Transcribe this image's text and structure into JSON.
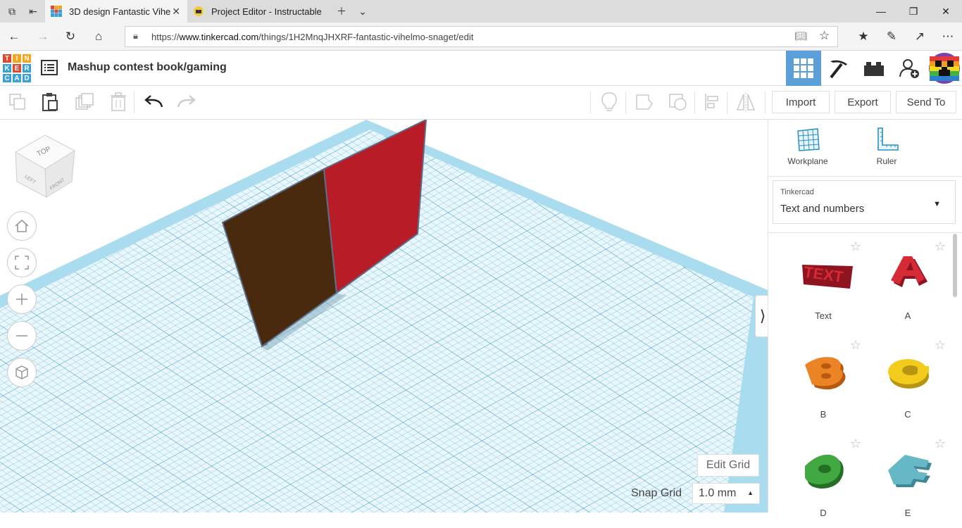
{
  "browser": {
    "tabs": [
      {
        "title": "3D design Fantastic Vihe",
        "active": true
      },
      {
        "title": "Project Editor - Instructable",
        "active": false
      }
    ],
    "url_prefix": "https://",
    "url_host": "www.tinkercad.com",
    "url_path": "/things/1H2MnqJHXRF-fantastic-vihelmo-snaget/edit"
  },
  "app": {
    "logo_letters": [
      "T",
      "I",
      "N",
      "K",
      "E",
      "R",
      "C",
      "A",
      "D"
    ],
    "logo_colors": [
      "#e2472c",
      "#f6a419",
      "#f6a419",
      "#3aa0d8",
      "#e2472c",
      "#3aa0d8",
      "#3aa0d8",
      "#3aa0d8",
      "#3aa0d8"
    ],
    "design_title": "Mashup contest book/gaming",
    "accent": "#5a9fd8"
  },
  "toolbar": {
    "import_label": "Import",
    "export_label": "Export",
    "sendto_label": "Send To"
  },
  "viewport": {
    "cube_top": "TOP",
    "cube_left": "LEFT",
    "cube_front": "FRONT",
    "edit_grid_label": "Edit Grid",
    "snap_grid_label": "Snap Grid",
    "snap_grid_value": "1.0 mm",
    "workplane_color": "#a9dcef",
    "brown_panel_color": "#4a2a0f",
    "red_panel_color": "#b81c26"
  },
  "panel": {
    "workplane_label": "Workplane",
    "ruler_label": "Ruler",
    "category_source": "Tinkercad",
    "category_value": "Text and numbers",
    "shapes": [
      {
        "label": "Text",
        "color": "#c8202e"
      },
      {
        "label": "A",
        "color": "#c8202e"
      },
      {
        "label": "B",
        "color": "#e87b1e"
      },
      {
        "label": "C",
        "color": "#f1c515"
      },
      {
        "label": "D",
        "color": "#3b9b3b"
      },
      {
        "label": "E",
        "color": "#5fb3c2"
      }
    ]
  }
}
